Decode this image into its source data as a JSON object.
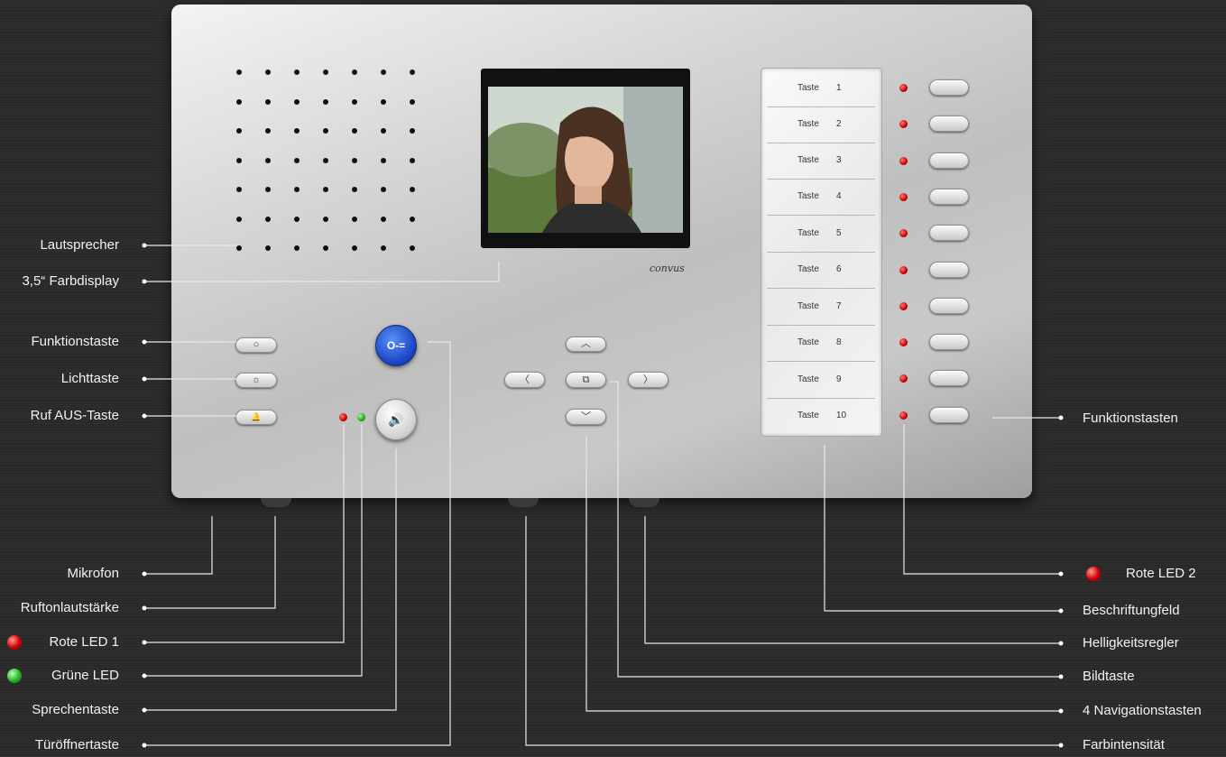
{
  "device": {
    "brand_logo": "convus",
    "display_buttons": {
      "function": "○",
      "light": "☼",
      "ringer_off": "🔔",
      "door_open": "O-=",
      "talk": "🔊"
    },
    "nav_buttons": {
      "up": "︿",
      "left": "〈",
      "picture": "⧉",
      "right": "〉",
      "down": "﹀"
    },
    "label_field": {
      "keys": [
        {
          "name": "Taste",
          "num": "1"
        },
        {
          "name": "Taste",
          "num": "2"
        },
        {
          "name": "Taste",
          "num": "3"
        },
        {
          "name": "Taste",
          "num": "4"
        },
        {
          "name": "Taste",
          "num": "5"
        },
        {
          "name": "Taste",
          "num": "6"
        },
        {
          "name": "Taste",
          "num": "7"
        },
        {
          "name": "Taste",
          "num": "8"
        },
        {
          "name": "Taste",
          "num": "9"
        },
        {
          "name": "Taste",
          "num": "10"
        }
      ]
    }
  },
  "labels_left": {
    "speaker": "Lautsprecher",
    "display": "3,5“ Farbdisplay",
    "function_key": "Funktionstaste",
    "light_key": "Lichttaste",
    "ringer_off_key": "Ruf AUS-Taste",
    "microphone": "Mikrofon",
    "ringer_volume": "Ruftonlautstärke",
    "red_led_1": "Rote LED 1",
    "green_led": "Grüne LED",
    "talk_key": "Sprechentaste",
    "door_opener_key": "Türöffnertaste"
  },
  "labels_right": {
    "function_keys": "Funktionstasten",
    "red_led_2": "Rote LED 2",
    "label_field": "Beschriftungfeld",
    "brightness": "Helligkeitsregler",
    "picture_key": "Bildtaste",
    "nav_keys": "4 Navigationstasten",
    "color_intensity": "Farbintensität"
  },
  "colors": {
    "background": "#2a2a2a",
    "led_red": "#c80000",
    "led_green": "#1fa61f",
    "door_button": "#1c46c4"
  }
}
